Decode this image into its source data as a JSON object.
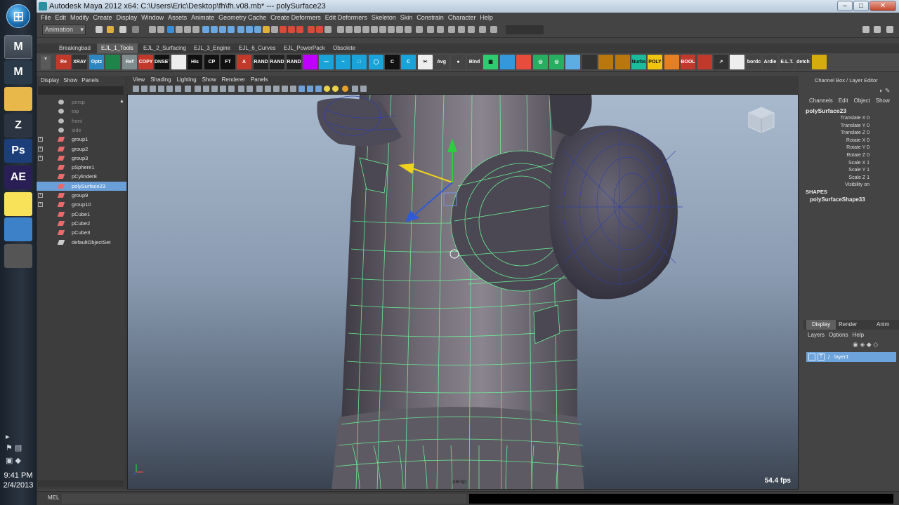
{
  "taskbar": {
    "clock_time": "9:41 PM",
    "clock_date": "2/4/2013",
    "apps": [
      {
        "name": "maya-app-icon",
        "label": "M"
      },
      {
        "name": "maya-app-icon-2",
        "label": "M"
      },
      {
        "name": "folder-icon",
        "label": ""
      },
      {
        "name": "zbrush-icon",
        "label": "Z"
      },
      {
        "name": "photoshop-icon",
        "label": "Ps"
      },
      {
        "name": "aftereffects-icon",
        "label": "AE"
      },
      {
        "name": "sticky-notes-icon",
        "label": ""
      },
      {
        "name": "image-viewer-icon",
        "label": ""
      },
      {
        "name": "clip-tool-icon",
        "label": ""
      }
    ]
  },
  "window": {
    "title": "Autodesk Maya 2012 x64: C:\\Users\\Eric\\Desktop\\fh\\fh.v08.mb*   ---   polySurface23"
  },
  "menubar": [
    "File",
    "Edit",
    "Modify",
    "Create",
    "Display",
    "Window",
    "Assets",
    "Animate",
    "Geometry Cache",
    "Create Deformers",
    "Edit Deformers",
    "Skeleton",
    "Skin",
    "Constrain",
    "Character",
    "Help"
  ],
  "status_line": {
    "mode": "Animation"
  },
  "shelf_tabs": [
    {
      "label": "Breakingbad",
      "active": false
    },
    {
      "label": "EJL_1_Tools",
      "active": true
    },
    {
      "label": "EJL_2_Surfacing",
      "active": false
    },
    {
      "label": "EJL_3_Engine",
      "active": false
    },
    {
      "label": "EJL_6_Curves",
      "active": false
    },
    {
      "label": "EJL_PowerPack",
      "active": false
    },
    {
      "label": "Obsolete",
      "active": false
    }
  ],
  "shelf_icons": [
    {
      "label": "Re Name",
      "color": "#c0392b"
    },
    {
      "label": "XRAY",
      "color": "#333333"
    },
    {
      "label": "Optz",
      "color": "#2e86c1"
    },
    {
      "label": "",
      "color": "#1e8449"
    },
    {
      "label": "Ref",
      "color": "#7f8c8d"
    },
    {
      "label": "COPY",
      "color": "#c0392b"
    },
    {
      "label": "DNSET",
      "color": "#111111"
    },
    {
      "label": "",
      "color": "#eeeeee"
    },
    {
      "label": "His",
      "color": "#111111"
    },
    {
      "label": "CP",
      "color": "#111111"
    },
    {
      "label": "FT",
      "color": "#111111"
    },
    {
      "label": "A",
      "color": "#c0392b"
    },
    {
      "label": "RAND",
      "color": "#222222"
    },
    {
      "label": "RAND",
      "color": "#222222"
    },
    {
      "label": "RAND",
      "color": "#222222"
    },
    {
      "label": "",
      "color": "#c000ff"
    },
    {
      "label": "—",
      "color": "#1aa3d9"
    },
    {
      "label": "~",
      "color": "#1aa3d9"
    },
    {
      "label": "□",
      "color": "#1aa3d9"
    },
    {
      "label": "◯",
      "color": "#1aa3d9"
    },
    {
      "label": "C",
      "color": "#111111"
    },
    {
      "label": "C",
      "color": "#1aa3d9"
    },
    {
      "label": "✂",
      "color": "#eeeeee"
    },
    {
      "label": "Avg",
      "color": "#444444"
    },
    {
      "label": "●",
      "color": "#444444"
    },
    {
      "label": "Blnd",
      "color": "#444444"
    },
    {
      "label": "▦",
      "color": "#2ecc71"
    },
    {
      "label": "",
      "color": "#3498db"
    },
    {
      "label": "",
      "color": "#e74c3c"
    },
    {
      "label": "◎",
      "color": "#27ae60"
    },
    {
      "label": "◎",
      "color": "#27ae60"
    },
    {
      "label": "",
      "color": "#5dade2"
    },
    {
      "label": "",
      "color": "#333333"
    },
    {
      "label": "",
      "color": "#b9770e"
    },
    {
      "label": "",
      "color": "#b9770e"
    },
    {
      "label": "Nurbs",
      "color": "#1abc9c"
    },
    {
      "label": "POLY",
      "color": "#f1c40f"
    },
    {
      "label": "",
      "color": "#e67e22"
    },
    {
      "label": "BOOL",
      "color": "#c0392b"
    },
    {
      "label": "",
      "color": "#c0392b"
    },
    {
      "label": "↗",
      "color": "#333333"
    },
    {
      "label": "",
      "color": "#eeeeee"
    },
    {
      "label": "bordc",
      "color": "#444444"
    },
    {
      "label": "Ardie",
      "color": "#444444"
    },
    {
      "label": "E.L.T.",
      "color": "#444444"
    },
    {
      "label": "detch",
      "color": "#444444"
    },
    {
      "label": "",
      "color": "#d4ac0d"
    }
  ],
  "outliner": {
    "menu": [
      "Display",
      "Show",
      "Panels"
    ],
    "items": [
      {
        "label": "persp",
        "dim": true,
        "expand": false,
        "selected": false,
        "icon": "camera"
      },
      {
        "label": "top",
        "dim": true,
        "expand": false,
        "selected": false,
        "icon": "camera"
      },
      {
        "label": "front",
        "dim": true,
        "expand": false,
        "selected": false,
        "icon": "camera"
      },
      {
        "label": "side",
        "dim": true,
        "expand": false,
        "selected": false,
        "icon": "camera"
      },
      {
        "label": "group1",
        "dim": false,
        "expand": true,
        "selected": false,
        "icon": "group"
      },
      {
        "label": "group2",
        "dim": false,
        "expand": true,
        "selected": false,
        "icon": "group"
      },
      {
        "label": "group3",
        "dim": false,
        "expand": true,
        "selected": false,
        "icon": "group"
      },
      {
        "label": "pSphere1",
        "dim": false,
        "expand": false,
        "selected": false,
        "icon": "mesh"
      },
      {
        "label": "pCylinder8",
        "dim": false,
        "expand": false,
        "selected": false,
        "icon": "mesh"
      },
      {
        "label": "polySurface23",
        "dim": false,
        "expand": false,
        "selected": true,
        "icon": "mesh"
      },
      {
        "label": "group9",
        "dim": false,
        "expand": true,
        "selected": false,
        "icon": "group"
      },
      {
        "label": "group10",
        "dim": false,
        "expand": true,
        "selected": false,
        "icon": "group"
      },
      {
        "label": "pCube1",
        "dim": false,
        "expand": false,
        "selected": false,
        "icon": "mesh"
      },
      {
        "label": "pCube2",
        "dim": false,
        "expand": false,
        "selected": false,
        "icon": "mesh"
      },
      {
        "label": "pCube3",
        "dim": false,
        "expand": false,
        "selected": false,
        "icon": "mesh"
      },
      {
        "label": "defaultObjectSet",
        "dim": false,
        "expand": false,
        "selected": false,
        "icon": "set"
      }
    ]
  },
  "viewport": {
    "menu": [
      "View",
      "Shading",
      "Lighting",
      "Show",
      "Renderer",
      "Panels"
    ],
    "fps": "54.4 fps",
    "camera": "persp"
  },
  "channel_box": {
    "title": "Channel Box / Layer Editor",
    "menu": [
      "Channels",
      "Edit",
      "Object",
      "Show"
    ],
    "object": "polySurface23",
    "attributes": [
      "Translate X 0",
      "Translate Y 0",
      "Translate Z 0",
      "Rotate X 0",
      "Rotate Y 0",
      "Rotate Z 0",
      "Scale X 1",
      "Scale Y 1",
      "Scale Z 1",
      "Visibility on"
    ],
    "shapes_header": "SHAPES",
    "shape_name": "polySurfaceShape33"
  },
  "layer_editor": {
    "tabs": [
      {
        "label": "Display",
        "active": true
      },
      {
        "label": "Render",
        "active": false
      },
      {
        "label": "Anim",
        "active": false
      }
    ],
    "menu": [
      "Layers",
      "Options",
      "Help"
    ],
    "layer": {
      "v": "V",
      "t": "T",
      "name": "layer1"
    }
  },
  "command_line": {
    "label": "MEL"
  }
}
